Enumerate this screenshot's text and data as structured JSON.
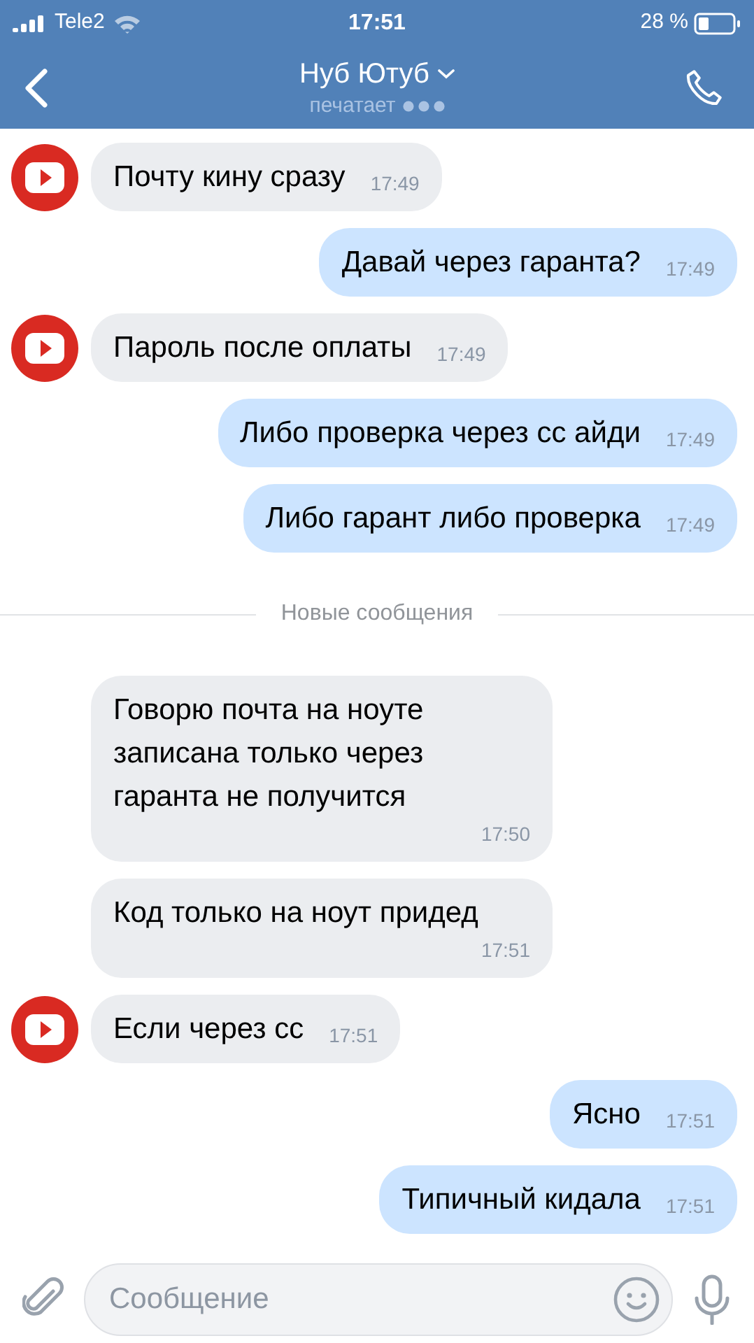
{
  "status_bar": {
    "carrier": "Tele2",
    "time": "17:51",
    "battery": "28 %"
  },
  "header": {
    "title": "Нуб Ютуб",
    "subtitle": "печатает"
  },
  "messages": [
    {
      "kind": "incoming",
      "text": "Почту кину сразу",
      "time": "17:49",
      "avatar": true
    },
    {
      "kind": "outgoing",
      "text": "Давай через гаранта?",
      "time": "17:49"
    },
    {
      "kind": "incoming",
      "text": "Пароль после оплаты",
      "time": "17:49",
      "avatar": true
    },
    {
      "kind": "outgoing",
      "text": "Либо проверка через сс айди",
      "time": "17:49"
    },
    {
      "kind": "outgoing",
      "text": "Либо гарант либо проверка",
      "time": "17:49"
    },
    {
      "kind": "divider",
      "text": "Новые сообщения"
    },
    {
      "kind": "incoming",
      "text": "Говорю почта на ноуте записана только через гаранта не получится",
      "time": "17:50",
      "avatar": false
    },
    {
      "kind": "incoming",
      "text": "Код только на ноут придед",
      "time": "17:51",
      "avatar": false
    },
    {
      "kind": "incoming",
      "text": "Если через сс",
      "time": "17:51",
      "avatar": true
    },
    {
      "kind": "outgoing",
      "text": "Ясно",
      "time": "17:51"
    },
    {
      "kind": "outgoing",
      "text": "Типичный кидала",
      "time": "17:51"
    }
  ],
  "composer": {
    "placeholder": "Сообщение"
  }
}
